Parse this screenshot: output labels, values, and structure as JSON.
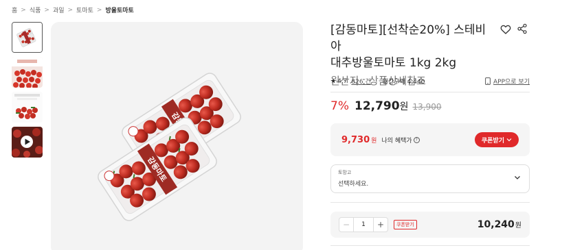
{
  "breadcrumb": [
    "홈",
    "식품",
    "과일",
    "토마토",
    "방울토마토"
  ],
  "product": {
    "title_line1": "[감동마토][선착순20%] 스테비아",
    "title_line2": "대추방울토마토 1kg 2kg",
    "origin": "원산지 : 상품상세참조",
    "package_label": "감동마토"
  },
  "rating": {
    "score": "4.7",
    "reviews": "826 건",
    "monthly_purchase": "월간구매 4,440",
    "app_link": "APP으로 보기"
  },
  "pricing": {
    "discount": "7%",
    "price": "12,790",
    "currency": "원",
    "original_price": "13,900"
  },
  "benefit": {
    "price": "9,730",
    "currency": "원",
    "label": "나의 혜택가",
    "info_glyph": "?",
    "coupon_button": "쿠폰받기"
  },
  "option": {
    "label": "토망고",
    "placeholder": "선택하세요."
  },
  "quantity": {
    "minus": "−",
    "value": "1",
    "plus": "+",
    "coupon_tag": "쿠폰받기",
    "total": "10,240",
    "currency": "원"
  },
  "icons": {
    "breadcrumb_separator": "chevron-right-icon",
    "wishlist": "heart-outline-icon",
    "share": "share-icon",
    "star": "star-icon",
    "mobile": "mobile-phone-icon",
    "coupon_dropdown": "chevron-down-icon",
    "option_dropdown": "chevron-down-icon",
    "video_play": "play-icon"
  },
  "colors": {
    "accent": "#e0292a",
    "panel_bg": "#f5f5f5",
    "image_bg": "#f3f3f3"
  }
}
